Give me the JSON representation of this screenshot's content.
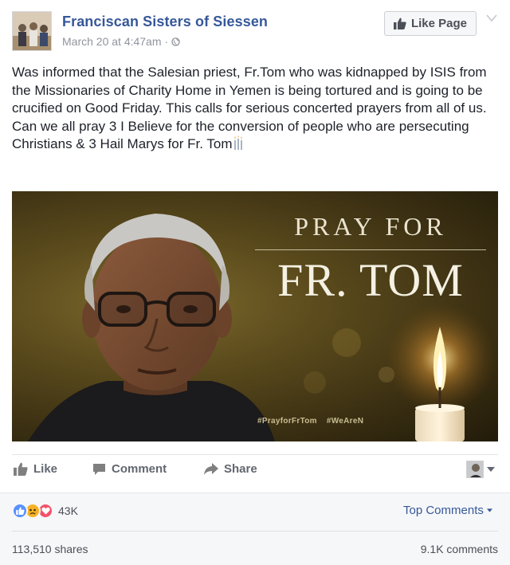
{
  "header": {
    "page_name": "Franciscan Sisters of Siessen",
    "timestamp": "March 20 at 4:47am",
    "separator": "·",
    "like_page_label": "Like Page"
  },
  "post": {
    "paragraphs": [
      "Was informed that the Salesian priest, Fr.Tom who was kidnapped by ISIS from the Missionaries of Charity Home in Yemen is being tortured and is going to be crucified on Good Friday. This calls for serious concerted prayers from all of us.",
      "Can we all pray 3 I Believe for the conversion of people who are persecuting Christians & 3 Hail Marys for Fr. Tom"
    ]
  },
  "image": {
    "line1": "PRAY FOR",
    "line2": "FR. TOM",
    "hashtags": [
      "#PrayforFrTom",
      "#WeAreN"
    ]
  },
  "actions": {
    "like": "Like",
    "comment": "Comment",
    "share": "Share"
  },
  "reactions": {
    "icons": [
      "like-reaction-icon",
      "sad-reaction-icon",
      "love-reaction-icon"
    ],
    "count": "43K",
    "sort_label": "Top Comments",
    "shares": "113,510 shares",
    "comments": "9.1K comments"
  },
  "colors": {
    "link_blue": "#365899",
    "like_blue": "#5890ff",
    "love_red": "#f25268",
    "sad_yellow": "#f7b125"
  }
}
